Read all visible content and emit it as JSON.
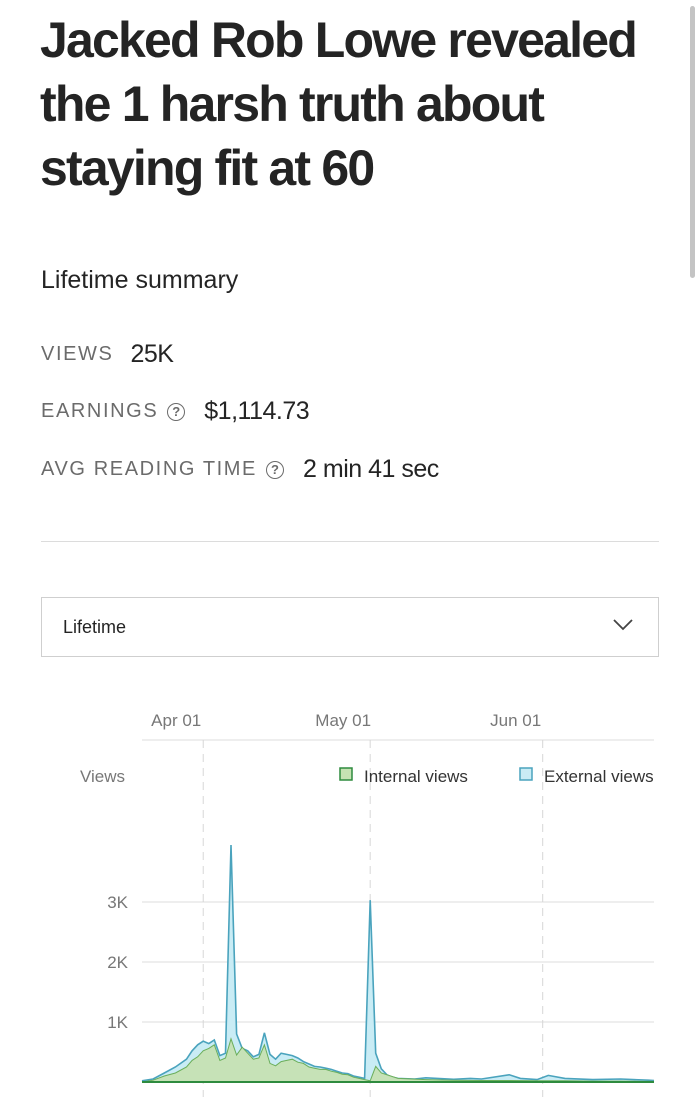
{
  "article": {
    "title": "Jacked Rob Lowe revealed the 1 harsh truth about staying fit at 60"
  },
  "summary": {
    "heading": "Lifetime summary",
    "views_label": "VIEWS",
    "views_value": "25K",
    "earnings_label": "EARNINGS",
    "earnings_value": "$1,114.73",
    "reading_label": "AVG READING TIME",
    "reading_value": "2 min 41 sec",
    "help_icon": "question-circle-icon"
  },
  "range_select": {
    "selected": "Lifetime",
    "icon": "chevron-down-icon"
  },
  "colors": {
    "internal_fill": "#c6e2b3",
    "internal_line": "#2e8b3e",
    "external_fill": "#c9ecf5",
    "external_line": "#4aa3bd",
    "grid": "#dddddd"
  },
  "chart_data": {
    "type": "area",
    "ylabel": "Views",
    "x_ticks": [
      "Apr 01",
      "May 01",
      "Jun 01"
    ],
    "x_tick_days": [
      0,
      30,
      61
    ],
    "y_ticks": [
      "1K",
      "2K",
      "3K"
    ],
    "y_tick_values": [
      1000,
      2000,
      3000
    ],
    "xlim": [
      -11,
      81
    ],
    "ylim": [
      0,
      4200
    ],
    "legend": [
      "Internal views",
      "External views"
    ],
    "legend_position": "top-right",
    "series": [
      {
        "name": "Internal views",
        "x": [
          -11,
          -9,
          -7,
          -5,
          -3,
          -2,
          -1,
          0,
          1,
          2,
          3,
          4,
          5,
          6,
          7,
          8,
          9,
          10,
          11,
          12,
          13,
          14,
          15,
          16,
          17,
          18,
          19,
          20,
          21,
          22,
          23,
          24,
          25,
          26,
          27,
          28,
          29,
          30,
          31,
          32,
          35,
          40,
          45,
          50,
          55,
          60,
          65,
          70,
          75,
          80,
          81
        ],
        "values": [
          0,
          30,
          100,
          150,
          250,
          360,
          420,
          520,
          560,
          620,
          360,
          400,
          720,
          450,
          580,
          480,
          380,
          400,
          620,
          310,
          270,
          340,
          360,
          380,
          330,
          310,
          250,
          230,
          210,
          210,
          180,
          160,
          130,
          120,
          80,
          60,
          40,
          20,
          260,
          150,
          60,
          40,
          30,
          25,
          25,
          20,
          20,
          15,
          15,
          10,
          10
        ]
      },
      {
        "name": "External views",
        "x": [
          -11,
          -9,
          -7,
          -5,
          -3,
          -2,
          -1,
          0,
          1,
          2,
          3,
          4,
          5,
          6,
          7,
          8,
          9,
          10,
          11,
          12,
          13,
          14,
          15,
          16,
          17,
          18,
          19,
          20,
          21,
          22,
          23,
          24,
          25,
          26,
          27,
          28,
          29,
          30,
          31,
          32,
          33,
          34,
          35,
          38,
          40,
          45,
          48,
          50,
          55,
          57,
          60,
          62,
          65,
          70,
          75,
          80,
          81
        ],
        "values": [
          20,
          50,
          150,
          250,
          380,
          520,
          620,
          680,
          640,
          700,
          440,
          480,
          3950,
          800,
          560,
          520,
          420,
          460,
          820,
          460,
          380,
          480,
          460,
          440,
          400,
          340,
          300,
          260,
          250,
          230,
          210,
          180,
          150,
          140,
          100,
          80,
          60,
          3030,
          480,
          220,
          120,
          80,
          60,
          50,
          70,
          45,
          60,
          50,
          120,
          60,
          40,
          110,
          60,
          40,
          50,
          30,
          25
        ]
      }
    ]
  }
}
